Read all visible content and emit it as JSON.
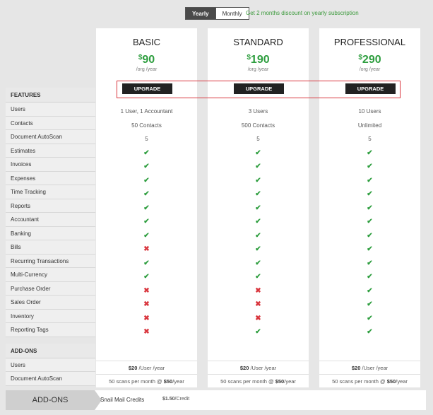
{
  "toggle": {
    "yearly": "Yearly",
    "monthly": "Monthly"
  },
  "promo": "Get 2 months discount on yearly subscription",
  "features_header": "FEATURES",
  "features": [
    "Users",
    "Contacts",
    "Document AutoScan",
    "Estimates",
    "Invoices",
    "Expenses",
    "Time Tracking",
    "Reports",
    "Accountant",
    "Banking",
    "Bills",
    "Recurring Transactions",
    "Multi-Currency",
    "Purchase Order",
    "Sales Order",
    "Inventory",
    "Reporting Tags"
  ],
  "addons_header": "ADD-ONS",
  "addons": [
    "Users",
    "Document AutoScan"
  ],
  "plans": [
    {
      "name": "BASIC",
      "currency": "$",
      "price": "90",
      "per": "/org /year",
      "button": "UPGRADE",
      "cells": [
        "1 User, 1 Accountant",
        "50 Contacts",
        "5",
        "check",
        "check",
        "check",
        "check",
        "check",
        "check",
        "check",
        "cross",
        "check",
        "check",
        "cross",
        "cross",
        "cross",
        "cross"
      ],
      "addon_users": {
        "price": "$20",
        "unit": " /User /year"
      },
      "addon_scan": {
        "pre": "50 scans per month @ ",
        "price": "$50",
        "unit": "/year"
      }
    },
    {
      "name": "STANDARD",
      "currency": "$",
      "price": "190",
      "per": "/org /year",
      "button": "UPGRADE",
      "cells": [
        "3 Users",
        "500 Contacts",
        "5",
        "check",
        "check",
        "check",
        "check",
        "check",
        "check",
        "check",
        "check",
        "check",
        "check",
        "cross",
        "cross",
        "cross",
        "check"
      ],
      "addon_users": {
        "price": "$20",
        "unit": " /User /year"
      },
      "addon_scan": {
        "pre": "50 scans per month @ ",
        "price": "$50",
        "unit": "/year"
      }
    },
    {
      "name": "PROFESSIONAL",
      "currency": "$",
      "price": "290",
      "per": "/org /year",
      "button": "UPGRADE",
      "cells": [
        "10 Users",
        "Unlimited",
        "5",
        "check",
        "check",
        "check",
        "check",
        "check",
        "check",
        "check",
        "check",
        "check",
        "check",
        "check",
        "check",
        "check",
        "check"
      ],
      "addon_users": {
        "price": "$20",
        "unit": " /User /year"
      },
      "addon_scan": {
        "pre": "50 scans per month @ ",
        "price": "$50",
        "unit": "/year"
      }
    }
  ],
  "bottom": {
    "tab": "ADD-ONS",
    "item": "Snail Mail Credits",
    "price": "$1.50",
    "unit": "/Credit"
  },
  "colors": {
    "green": "#2e9e3f",
    "red": "#d9363e",
    "dark": "#222222"
  },
  "icons": {
    "check": "check-icon",
    "cross": "cross-icon"
  }
}
